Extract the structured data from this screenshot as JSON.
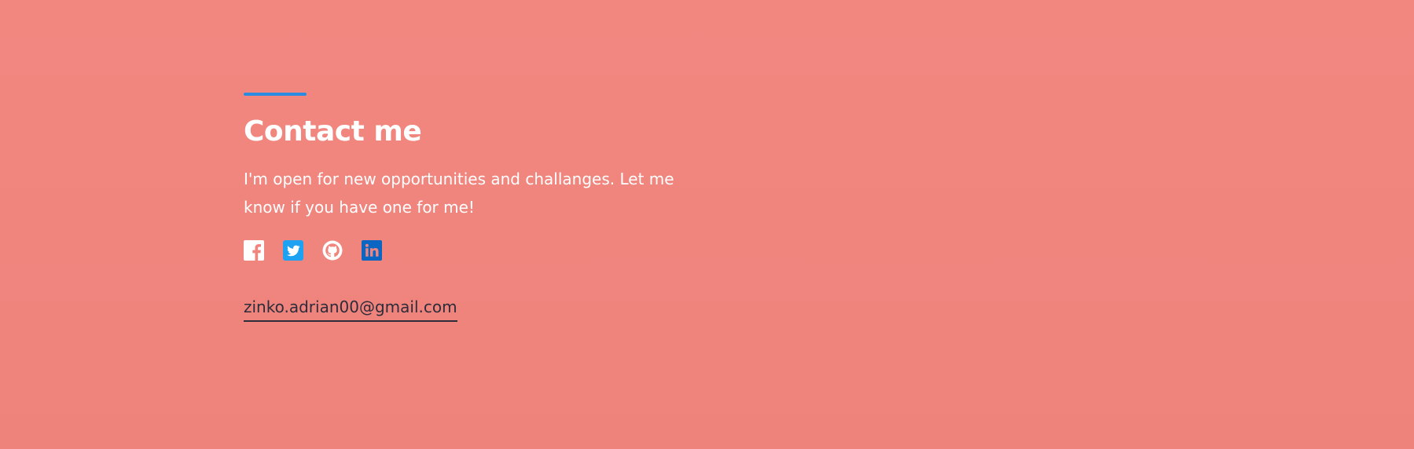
{
  "contact": {
    "title": "Contact me",
    "description": "I'm open for new opportunities and challanges. Let me know if you have one for me!",
    "email": "zinko.adrian00@gmail.com"
  },
  "social": [
    {
      "icon": "facebook-icon",
      "color": "#ffffff"
    },
    {
      "icon": "twitter-icon",
      "color": "#1da1f2"
    },
    {
      "icon": "github-icon",
      "color": "#ffffff"
    },
    {
      "icon": "linkedin-icon",
      "color": "#0a66c2"
    }
  ],
  "colors": {
    "background": "#f0857e",
    "accent": "#2a8ce0",
    "heading": "#ffffff",
    "email": "#2c2c3a"
  }
}
